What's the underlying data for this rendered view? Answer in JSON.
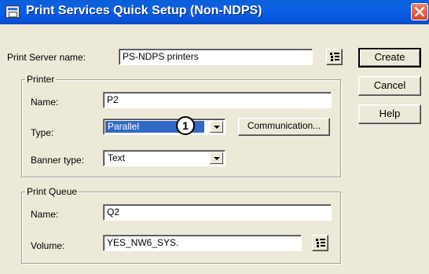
{
  "window": {
    "title": "Print Services Quick Setup (Non-NDPS)"
  },
  "server": {
    "label": "Print Server name:",
    "value": "PS-NDPS printers"
  },
  "buttons": {
    "create": "Create",
    "cancel": "Cancel",
    "help": "Help"
  },
  "printer": {
    "group_label": "Printer",
    "name_label": "Name:",
    "name_value": "P2",
    "type_label": "Type:",
    "type_value": "Parallel",
    "communication_button": "Communication...",
    "banner_label": "Banner type:",
    "banner_value": "Text"
  },
  "queue": {
    "group_label": "Print Queue",
    "name_label": "Name:",
    "name_value": "Q2",
    "volume_label": "Volume:",
    "volume_value": "YES_NW6_SYS."
  },
  "callout": {
    "number": "1"
  },
  "icons": {
    "browse": "browse-tree-icon",
    "close": "close-icon",
    "app": "app-window-icon",
    "dropdown": "chevron-down-icon"
  },
  "colors": {
    "titlebar": "#0a5fd8",
    "selection": "#316ac5",
    "close": "#d4482a",
    "dialog": "#ece9d8"
  }
}
